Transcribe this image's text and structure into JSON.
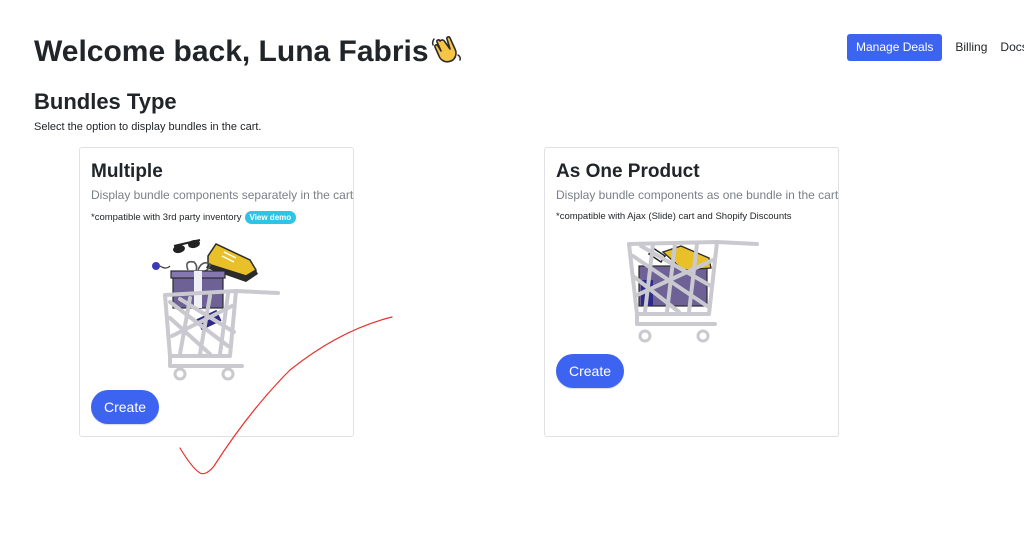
{
  "header": {
    "welcome": "Welcome back, Luna Fabris",
    "wave_icon": "waving-hand-icon"
  },
  "nav": {
    "manage_deals": "Manage Deals",
    "billing": "Billing",
    "docs": "Docs"
  },
  "section": {
    "title": "Bundles Type",
    "subtitle": "Select the option to display bundles in the cart."
  },
  "cards": [
    {
      "title": "Multiple",
      "description": "Display bundle components separately in the cart",
      "note": "*compatible with 3rd party inventory",
      "badge": "View demo",
      "button": "Create"
    },
    {
      "title": "As One Product",
      "description": "Display bundle components as one bundle in the cart",
      "note": "*compatible with Ajax (Slide) cart and Shopify Discounts",
      "button": "Create"
    }
  ],
  "colors": {
    "primary": "#3c64f0",
    "badge": "#2ec4e6",
    "annotation": "#e8322e"
  }
}
